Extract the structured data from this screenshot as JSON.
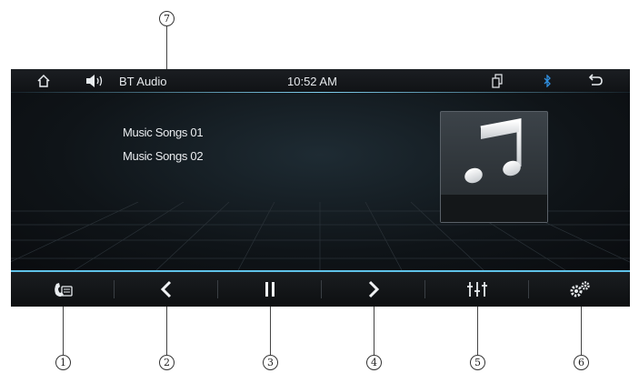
{
  "status_bar": {
    "source_label": "BT Audio",
    "clock": "10:52 AM"
  },
  "playlist": {
    "items": [
      {
        "label": "Music Songs 01"
      },
      {
        "label": "Music Songs 02"
      }
    ]
  },
  "album_art": {
    "icon": "music-note-icon"
  },
  "controls": [
    {
      "name": "phone-button",
      "icon": "phone-icon",
      "callout": "1"
    },
    {
      "name": "previous-button",
      "icon": "chevron-left-icon",
      "callout": "2"
    },
    {
      "name": "pause-button",
      "icon": "pause-icon",
      "callout": "3"
    },
    {
      "name": "next-button",
      "icon": "chevron-right-icon",
      "callout": "4"
    },
    {
      "name": "equalizer-button",
      "icon": "equalizer-icon",
      "callout": "5"
    },
    {
      "name": "settings-button",
      "icon": "gear-icon",
      "callout": "6"
    }
  ],
  "callout_top": "7",
  "colors": {
    "accent": "#5fc2e8",
    "bluetooth": "#2f8fe0",
    "background": "#0e1014"
  }
}
